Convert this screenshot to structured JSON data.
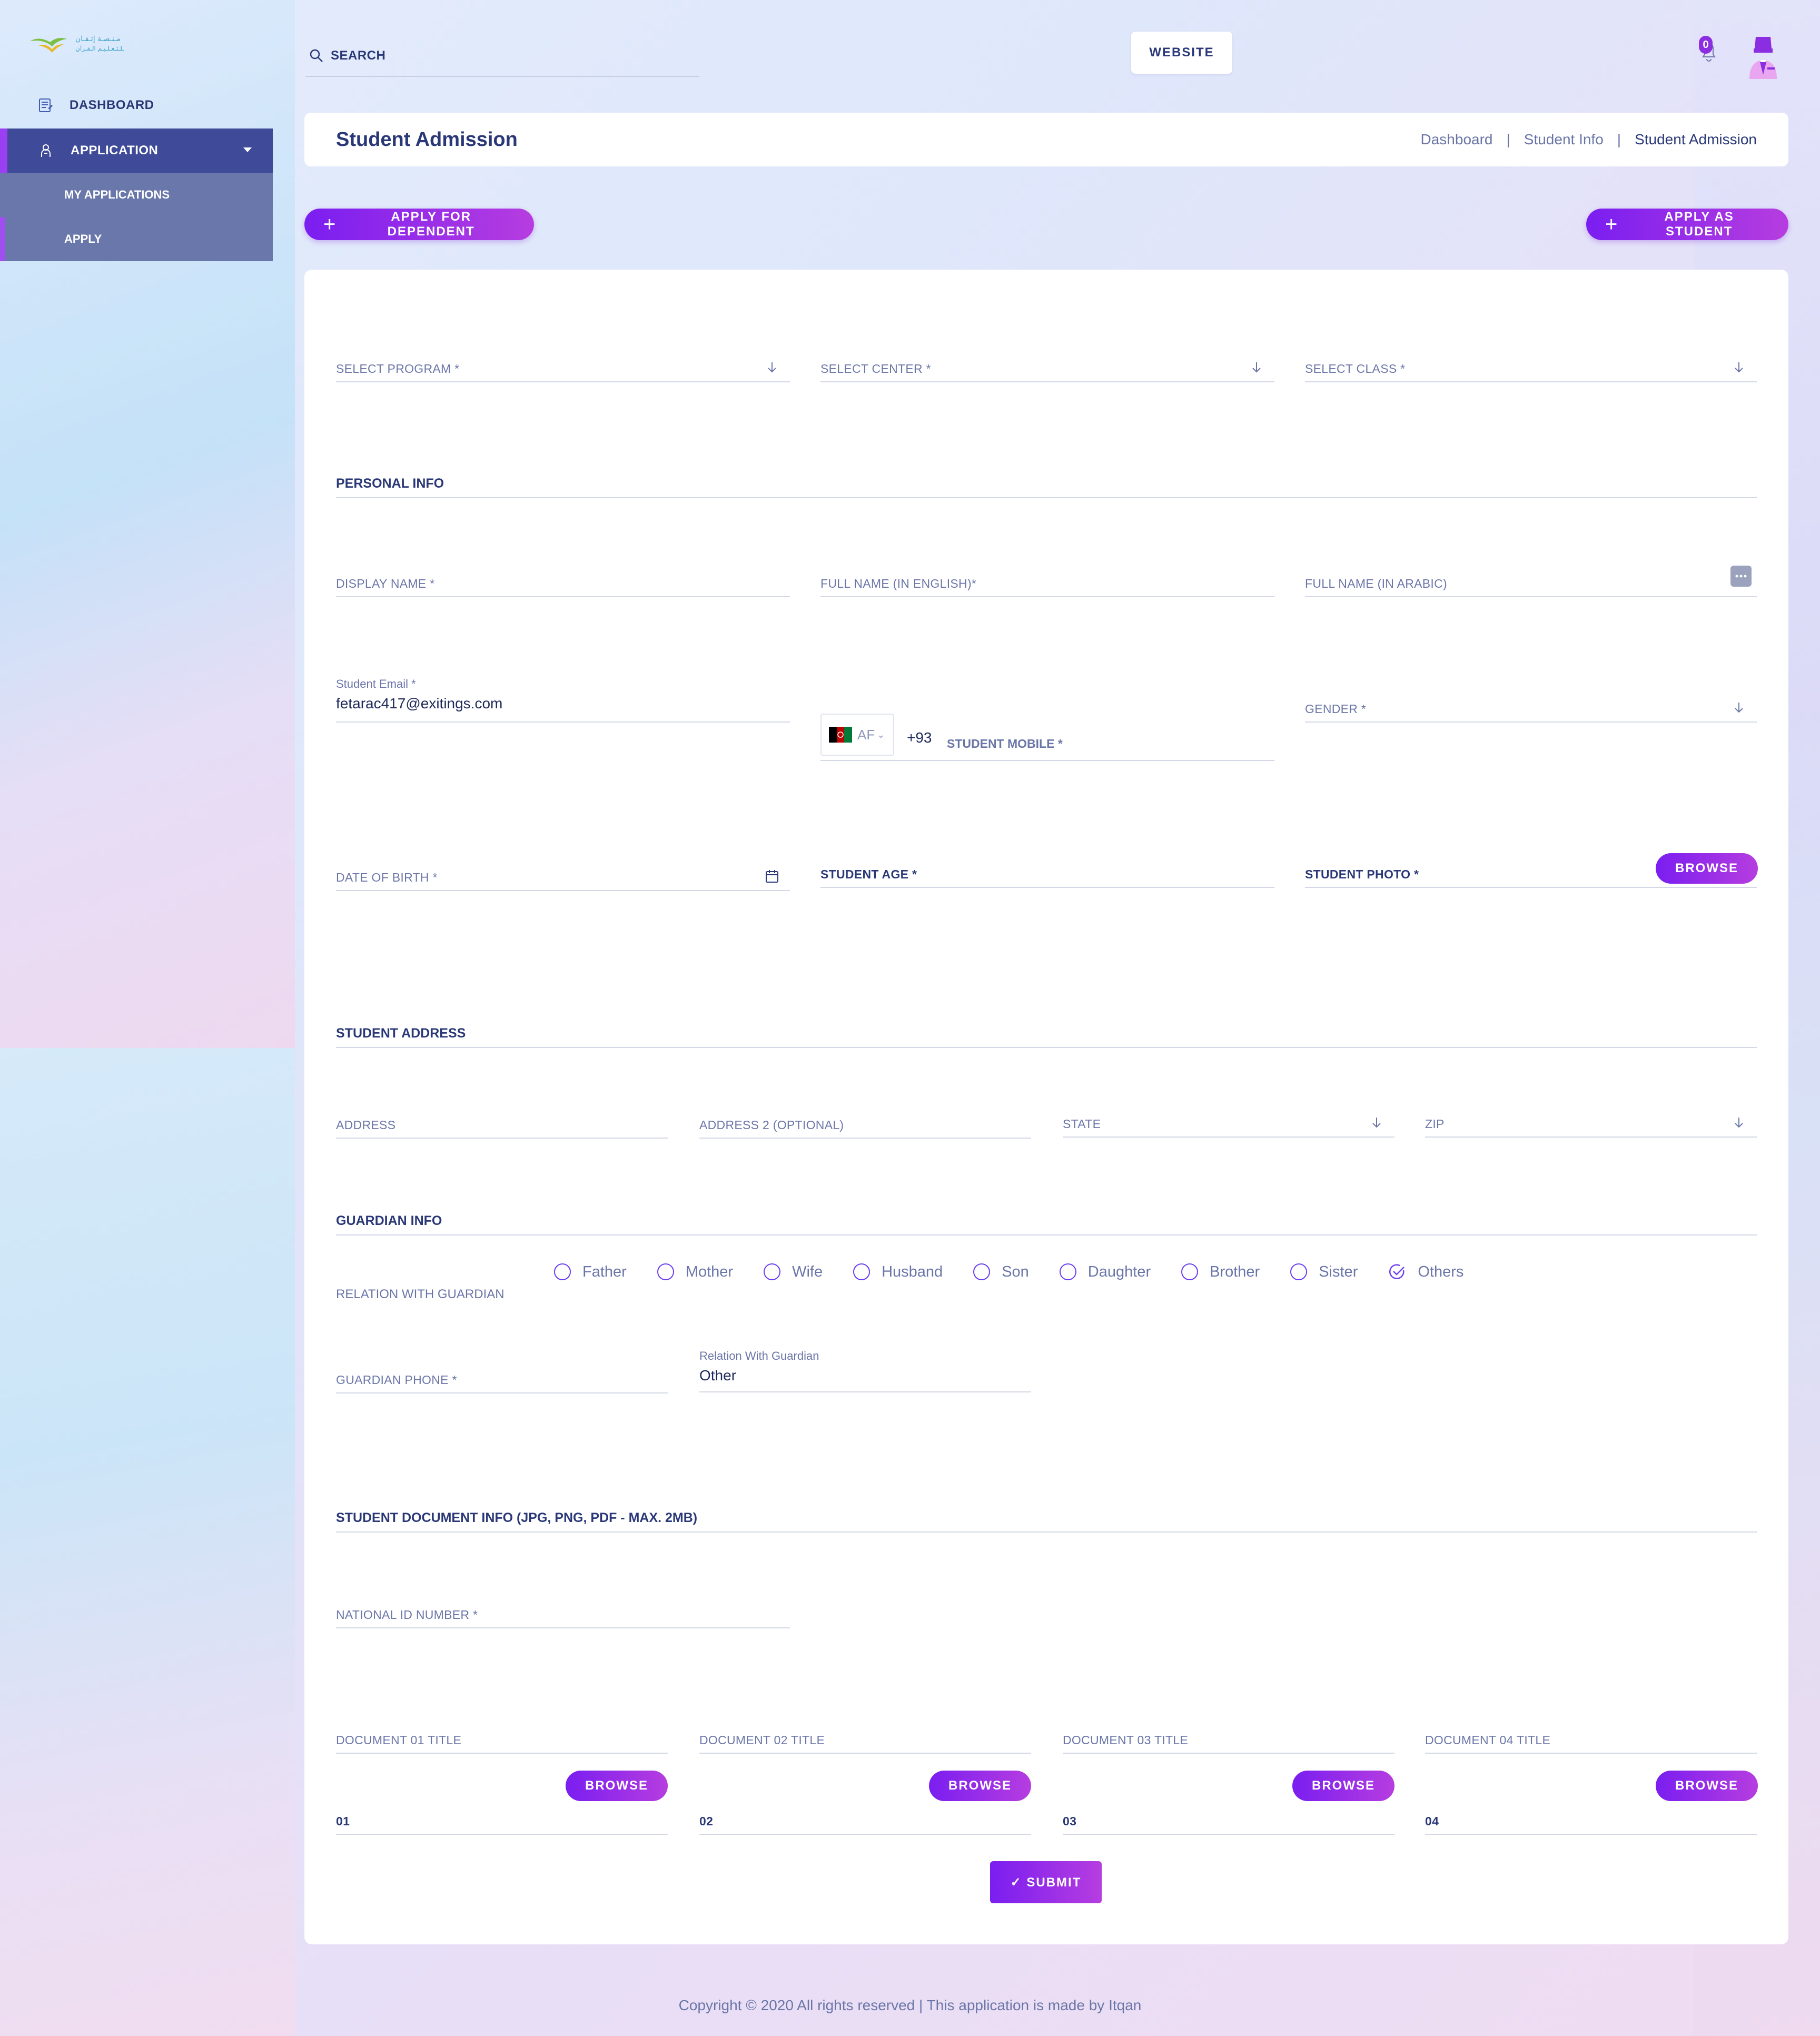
{
  "sidebar": {
    "items": [
      {
        "label": "DASHBOARD"
      },
      {
        "label": "APPLICATION"
      }
    ],
    "subitems": [
      {
        "label": "MY APPLICATIONS"
      },
      {
        "label": "APPLY"
      }
    ]
  },
  "topbar": {
    "search_label": "SEARCH",
    "website_label": "WEBSITE",
    "notification_count": "0"
  },
  "header": {
    "title": "Student Admission",
    "breadcrumb": [
      "Dashboard",
      "Student Info",
      "Student Admission"
    ],
    "separator": "|"
  },
  "actions": {
    "apply_dependent": "APPLY FOR DEPENDENT",
    "apply_student": "APPLY AS STUDENT",
    "plus": "+"
  },
  "form": {
    "select_program": "SELECT PROGRAM *",
    "select_center": "SELECT CENTER *",
    "select_class": "SELECT CLASS *",
    "personal_info": "PERSONAL INFO",
    "display_name": "DISPLAY NAME *",
    "full_name_en": "FULL NAME (IN ENGLISH)*",
    "full_name_ar": "FULL NAME (IN ARABIC)",
    "student_email_label": "Student Email *",
    "student_email_value": "fetarac417@exitings.com",
    "country_code": "AF",
    "dial_code": "+93",
    "student_mobile": "STUDENT MOBILE *",
    "gender": "GENDER *",
    "date_of_birth": "DATE OF BIRTH *",
    "student_age": "STUDENT AGE *",
    "student_photo": "STUDENT PHOTO *",
    "browse": "BROWSE",
    "student_address": "STUDENT ADDRESS",
    "address": "ADDRESS",
    "address2": "ADDRESS 2 (OPTIONAL)",
    "state": "STATE",
    "zip": "ZIP",
    "guardian_info": "GUARDIAN INFO",
    "relation_with_guardian": "RELATION WITH GUARDIAN",
    "relations": [
      "Father",
      "Mother",
      "Wife",
      "Husband",
      "Son",
      "Daughter",
      "Brother",
      "Sister",
      "Others"
    ],
    "selected_relation": "Others",
    "guardian_phone": "GUARDIAN PHONE *",
    "relation_label": "Relation With Guardian",
    "relation_value": "Other",
    "document_info": "STUDENT DOCUMENT INFO (JPG, PNG, PDF - MAX. 2MB)",
    "national_id": "NATIONAL ID NUMBER *",
    "doc_titles": [
      "DOCUMENT 01 TITLE",
      "DOCUMENT 02 TITLE",
      "DOCUMENT 03 TITLE",
      "DOCUMENT 04 TITLE"
    ],
    "doc_files": [
      "01",
      "02",
      "03",
      "04"
    ],
    "submit": "✓ SUBMIT"
  },
  "footer": {
    "text": "Copyright © 2020 All rights reserved | This application is made by Itqan"
  },
  "colors": {
    "accent": "#8b2de0",
    "nav_active": "#3f4b99",
    "nav_sub": "#6a77ab",
    "text_dark": "#2a3877"
  }
}
